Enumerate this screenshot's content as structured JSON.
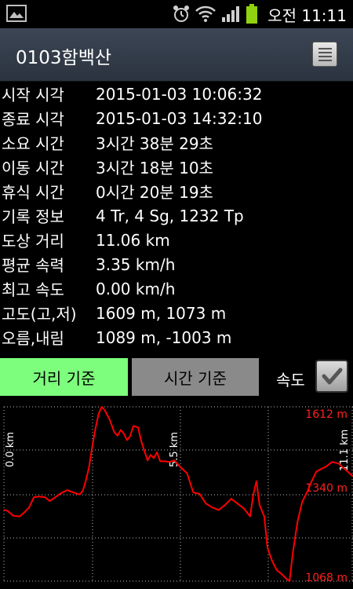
{
  "status_bar": {
    "time": "오전 11:11",
    "icons": [
      "gallery-icon",
      "alarm-icon",
      "wifi-icon",
      "signal-icon",
      "battery-icon"
    ]
  },
  "header": {
    "title": "0103함백산",
    "menu_icon": "list-menu-icon"
  },
  "info_rows": [
    {
      "label": "시작 시각",
      "value": "2015-01-03 10:06:32"
    },
    {
      "label": "종료 시각",
      "value": "2015-01-03 14:32:10"
    },
    {
      "label": "소요 시간",
      "value": "3시간 38분 29초"
    },
    {
      "label": "이동 시간",
      "value": "3시간 18분 10초"
    },
    {
      "label": "휴식 시간",
      "value": "0시간 20분 19초"
    },
    {
      "label": "기록 정보",
      "value": "4 Tr, 4 Sg, 1232 Tp"
    },
    {
      "label": "도상 거리",
      "value": "11.06 km"
    },
    {
      "label": "평균 속력",
      "value": "3.35 km/h"
    },
    {
      "label": "최고 속도",
      "value": "0.00 km/h"
    },
    {
      "label": "고도(고,저)",
      "value": "1609 m, 1073 m"
    },
    {
      "label": "오름,내림",
      "value": "1089 m, -1003 m"
    }
  ],
  "controls": {
    "distance_button": "거리 기준",
    "time_button": "시간 기준",
    "speed_label": "속도",
    "speed_checked": true
  },
  "colors": {
    "active_button": "#7dff7d",
    "inactive_button": "#8a8a8a",
    "profile_line": "#ff0000"
  },
  "chart_data": {
    "type": "line",
    "xlabel": "",
    "ylabel": "",
    "x_tick_labels": [
      "0.0 km",
      "5.5 km",
      "11.1 km"
    ],
    "y_tick_labels": [
      "1612 m",
      "1340 m",
      "1068 m"
    ],
    "ylim": [
      1068,
      1612
    ],
    "xlim": [
      0,
      11.06
    ],
    "grid": true,
    "series": [
      {
        "x": [
          0,
          0.1,
          0.2,
          0.3,
          0.5,
          0.65,
          0.8,
          0.95,
          1.1,
          1.3,
          1.45,
          1.6,
          1.8,
          2.0,
          2.2,
          2.4,
          2.5,
          2.6,
          2.7,
          2.8,
          2.9,
          3.0,
          3.1,
          3.2,
          3.35,
          3.5,
          3.6,
          3.7,
          3.8,
          3.9,
          4.0,
          4.1,
          4.25,
          4.35,
          4.45,
          4.55,
          4.65,
          4.75,
          4.85,
          4.95,
          5.1,
          5.25,
          5.4,
          5.6,
          5.8,
          6.0,
          6.2,
          6.4,
          6.6,
          6.8,
          7.0,
          7.2,
          7.4,
          7.6,
          7.8,
          7.9,
          8.0,
          8.1,
          8.25,
          8.35,
          8.5,
          8.65,
          8.8,
          8.95,
          9.05,
          9.15,
          9.3,
          9.45,
          9.6,
          9.75,
          9.9,
          10.05,
          10.2,
          10.4,
          10.6,
          10.8,
          11.06
        ],
        "y": [
          1290,
          1288,
          1280,
          1272,
          1270,
          1283,
          1298,
          1330,
          1332,
          1330,
          1318,
          1328,
          1342,
          1352,
          1345,
          1338,
          1350,
          1383,
          1425,
          1490,
          1545,
          1590,
          1612,
          1600,
          1572,
          1532,
          1522,
          1540,
          1528,
          1508,
          1520,
          1552,
          1548,
          1505,
          1475,
          1445,
          1462,
          1452,
          1470,
          1442,
          1442,
          1440,
          1445,
          1423,
          1405,
          1345,
          1340,
          1310,
          1298,
          1290,
          1305,
          1325,
          1310,
          1295,
          1270,
          1338,
          1380,
          1305,
          1270,
          1172,
          1130,
          1102,
          1090,
          1075,
          1068,
          1155,
          1253,
          1315,
          1345,
          1380,
          1410,
          1418,
          1425,
          1440,
          1435,
          1418,
          1395
        ]
      }
    ]
  }
}
